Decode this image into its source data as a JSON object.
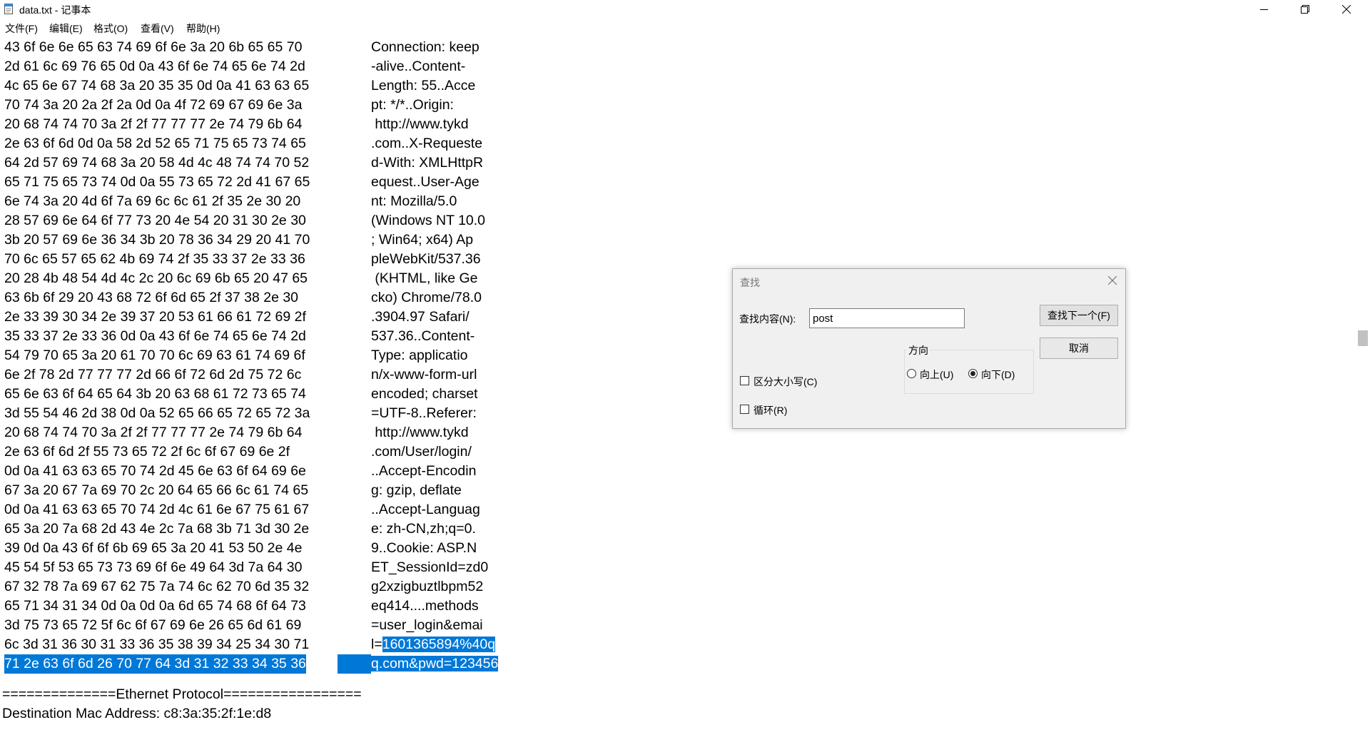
{
  "window": {
    "title": "data.txt - 记事本"
  },
  "menu": [
    "文件(F)",
    "编辑(E)",
    "格式(O)",
    "查看(V)",
    "帮助(H)"
  ],
  "editor": {
    "lines": [
      {
        "hex": "43 6f 6e 6e 65 63 74 69 6f 6e 3a 20 6b 65 65 70",
        "ascii": "Connection: keep",
        "ascii_sel": ""
      },
      {
        "hex": "2d 61 6c 69 76 65 0d 0a 43 6f 6e 74 65 6e 74 2d",
        "ascii": "-alive..Content-",
        "ascii_sel": ""
      },
      {
        "hex": "4c 65 6e 67 74 68 3a 20 35 35 0d 0a 41 63 63 65",
        "ascii": "Length: 55..Acce",
        "ascii_sel": ""
      },
      {
        "hex": "70 74 3a 20 2a 2f 2a 0d 0a 4f 72 69 67 69 6e 3a",
        "ascii": "pt: */*..Origin:",
        "ascii_sel": ""
      },
      {
        "hex": "20 68 74 74 70 3a 2f 2f 77 77 77 2e 74 79 6b 64",
        "ascii": " http://www.tykd",
        "ascii_sel": ""
      },
      {
        "hex": "2e 63 6f 6d 0d 0a 58 2d 52 65 71 75 65 73 74 65",
        "ascii": ".com..X-Requeste",
        "ascii_sel": ""
      },
      {
        "hex": "64 2d 57 69 74 68 3a 20 58 4d 4c 48 74 74 70 52",
        "ascii": "d-With: XMLHttpR",
        "ascii_sel": ""
      },
      {
        "hex": "65 71 75 65 73 74 0d 0a 55 73 65 72 2d 41 67 65",
        "ascii": "equest..User-Age",
        "ascii_sel": ""
      },
      {
        "hex": "6e 74 3a 20 4d 6f 7a 69 6c 6c 61 2f 35 2e 30 20",
        "ascii": "nt: Mozilla/5.0",
        "ascii_sel": ""
      },
      {
        "hex": "28 57 69 6e 64 6f 77 73 20 4e 54 20 31 30 2e 30",
        "ascii": "(Windows NT 10.0",
        "ascii_sel": ""
      },
      {
        "hex": "3b 20 57 69 6e 36 34 3b 20 78 36 34 29 20 41 70",
        "ascii": "; Win64; x64) Ap",
        "ascii_sel": ""
      },
      {
        "hex": "70 6c 65 57 65 62 4b 69 74 2f 35 33 37 2e 33 36",
        "ascii": "pleWebKit/537.36",
        "ascii_sel": ""
      },
      {
        "hex": "20 28 4b 48 54 4d 4c 2c 20 6c 69 6b 65 20 47 65",
        "ascii": " (KHTML, like Ge",
        "ascii_sel": ""
      },
      {
        "hex": "63 6b 6f 29 20 43 68 72 6f 6d 65 2f 37 38 2e 30",
        "ascii": "cko) Chrome/78.0",
        "ascii_sel": ""
      },
      {
        "hex": "2e 33 39 30 34 2e 39 37 20 53 61 66 61 72 69 2f",
        "ascii": ".3904.97 Safari/",
        "ascii_sel": ""
      },
      {
        "hex": "35 33 37 2e 33 36 0d 0a 43 6f 6e 74 65 6e 74 2d",
        "ascii": "537.36..Content-",
        "ascii_sel": ""
      },
      {
        "hex": "54 79 70 65 3a 20 61 70 70 6c 69 63 61 74 69 6f",
        "ascii": "Type: applicatio",
        "ascii_sel": ""
      },
      {
        "hex": "6e 2f 78 2d 77 77 77 2d 66 6f 72 6d 2d 75 72 6c",
        "ascii": "n/x-www-form-url",
        "ascii_sel": ""
      },
      {
        "hex": "65 6e 63 6f 64 65 64 3b 20 63 68 61 72 73 65 74",
        "ascii": "encoded; charset",
        "ascii_sel": ""
      },
      {
        "hex": "3d 55 54 46 2d 38 0d 0a 52 65 66 65 72 65 72 3a",
        "ascii": "=UTF-8..Referer:",
        "ascii_sel": ""
      },
      {
        "hex": "20 68 74 74 70 3a 2f 2f 77 77 77 2e 74 79 6b 64",
        "ascii": " http://www.tykd",
        "ascii_sel": ""
      },
      {
        "hex": "2e 63 6f 6d 2f 55 73 65 72 2f 6c 6f 67 69 6e 2f",
        "ascii": ".com/User/login/",
        "ascii_sel": ""
      },
      {
        "hex": "0d 0a 41 63 63 65 70 74 2d 45 6e 63 6f 64 69 6e",
        "ascii": "..Accept-Encodin",
        "ascii_sel": ""
      },
      {
        "hex": "67 3a 20 67 7a 69 70 2c 20 64 65 66 6c 61 74 65",
        "ascii": "g: gzip, deflate",
        "ascii_sel": ""
      },
      {
        "hex": "0d 0a 41 63 63 65 70 74 2d 4c 61 6e 67 75 61 67",
        "ascii": "..Accept-Languag",
        "ascii_sel": ""
      },
      {
        "hex": "65 3a 20 7a 68 2d 43 4e 2c 7a 68 3b 71 3d 30 2e",
        "ascii": "e: zh-CN,zh;q=0.",
        "ascii_sel": ""
      },
      {
        "hex": "39 0d 0a 43 6f 6f 6b 69 65 3a 20 41 53 50 2e 4e",
        "ascii": "9..Cookie: ASP.N",
        "ascii_sel": ""
      },
      {
        "hex": "45 54 5f 53 65 73 73 69 6f 6e 49 64 3d 7a 64 30",
        "ascii": "ET_SessionId=zd0",
        "ascii_sel": ""
      },
      {
        "hex": "67 32 78 7a 69 67 62 75 7a 74 6c 62 70 6d 35 32",
        "ascii": "g2xzigbuztlbpm52",
        "ascii_sel": ""
      },
      {
        "hex": "65 71 34 31 34 0d 0a 0d 0a 6d 65 74 68 6f 64 73",
        "ascii": "eq414....methods",
        "ascii_sel": ""
      },
      {
        "hex": "3d 75 73 65 72 5f 6c 6f 67 69 6e 26 65 6d 61 69",
        "ascii": "=user_login&emai",
        "ascii_sel": ""
      },
      {
        "hex": "6c 3d 31 36 30 31 33 36 35 38 39 34 25 34 30 71",
        "ascii": "l=",
        "ascii_sel": "1601365894%40q"
      },
      {
        "hex": "71 2e 63 6f 6d 26 70 77 64 3d 31 32 33 34 35 36",
        "ascii": "q.com&pwd=123456",
        "ascii_sel": "",
        "selected": true
      }
    ],
    "footer": [
      "==============Ethernet Protocol=================",
      "Destination Mac Address: c8:3a:35:2f:1e:d8"
    ]
  },
  "find_dialog": {
    "title": "查找",
    "find_label": "查找内容(N):",
    "find_value": "post",
    "find_next": "查找下一个(F)",
    "cancel": "取消",
    "direction_title": "方向",
    "up": "向上(U)",
    "down": "向下(D)",
    "match_case": "区分大小写(C)",
    "wrap": "循环(R)"
  }
}
